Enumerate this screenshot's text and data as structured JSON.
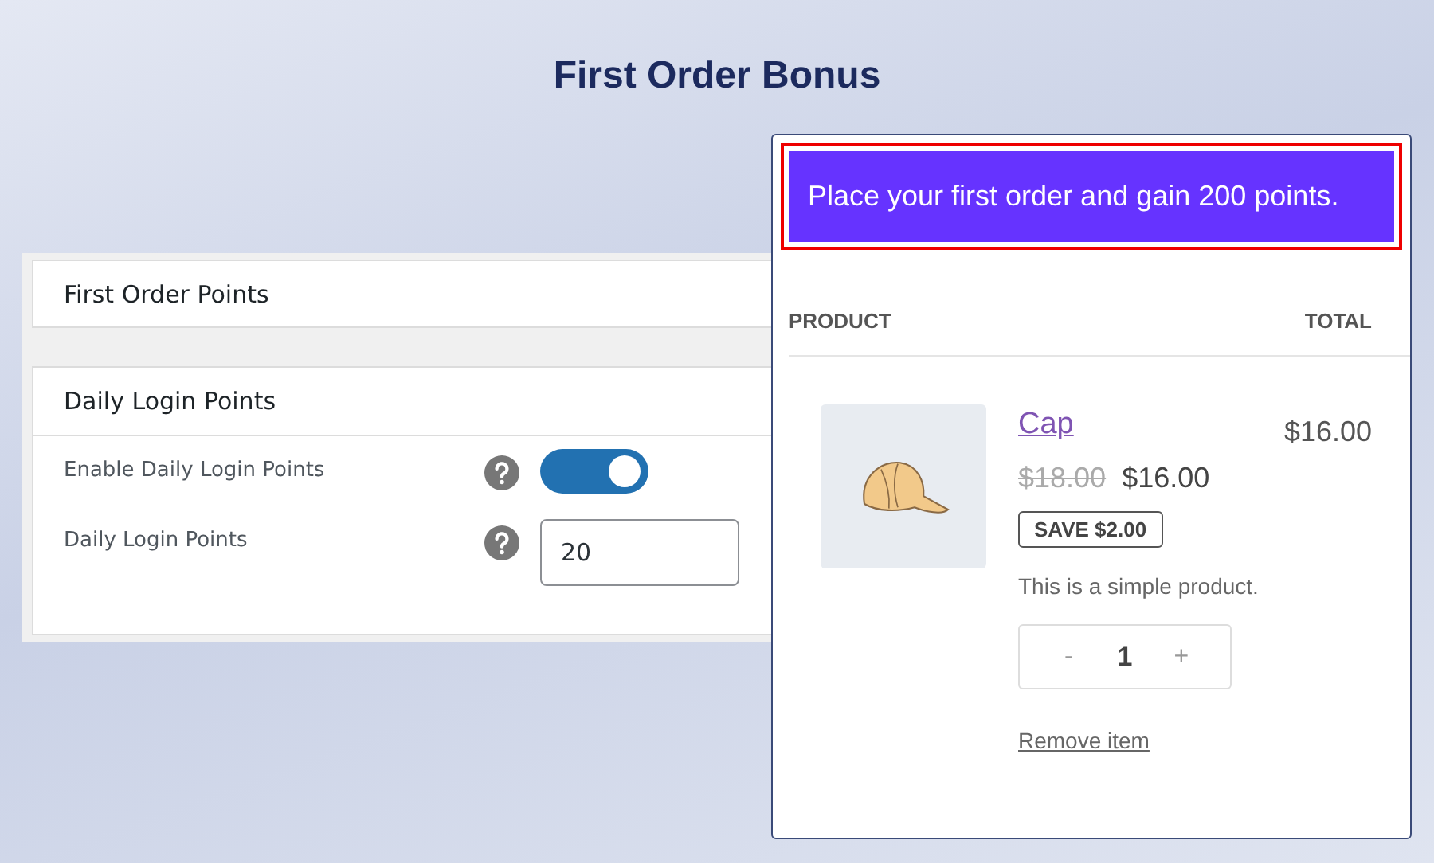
{
  "page": {
    "title": "First Order Bonus"
  },
  "settings": {
    "sections": [
      {
        "title": "First Order Points"
      },
      {
        "title": "Daily Login Points",
        "fields": [
          {
            "kind": "toggle",
            "label": "Enable Daily Login Points",
            "on": true
          },
          {
            "kind": "number",
            "label": "Daily Login Points",
            "value": "20"
          }
        ]
      }
    ]
  },
  "cart": {
    "notice": "Place your first order and gain 200 points.",
    "columns": [
      "PRODUCT",
      "TOTAL"
    ],
    "item": {
      "name": "Cap",
      "regular_price": "$18.00",
      "sale_price": "$16.00",
      "saving": "SAVE $2.00",
      "description": "This is a simple product.",
      "decrement": "-",
      "quantity": "1",
      "increment": "+",
      "remove": "Remove item",
      "total": "$16.00"
    }
  }
}
